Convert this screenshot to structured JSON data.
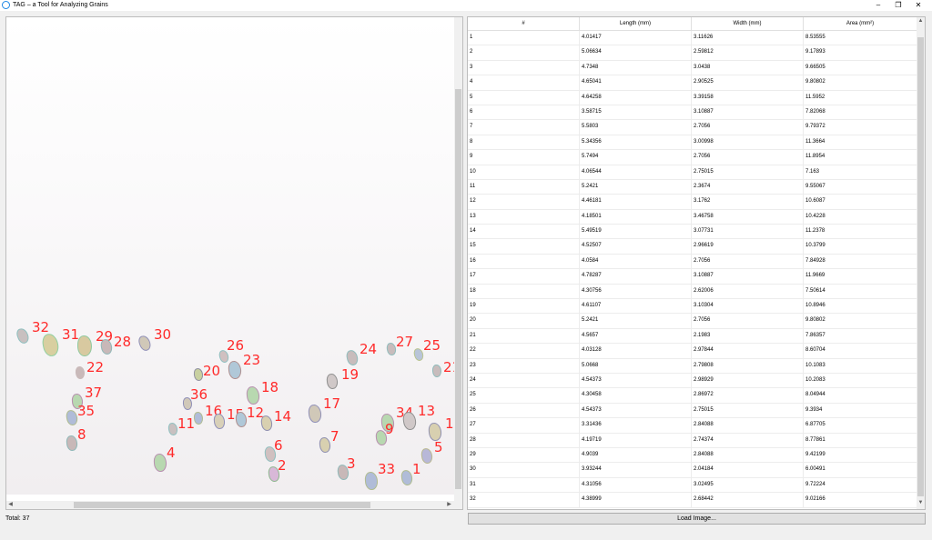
{
  "window": {
    "title": "TAG – a Tool for Analyzing Grains",
    "minimize_icon": "–",
    "maximize_icon": "❐",
    "close_icon": "✕"
  },
  "image_view": {
    "labels": [
      "32",
      "31",
      "29",
      "28",
      "30",
      "26",
      "22",
      "20",
      "23",
      "18",
      "24",
      "27",
      "25",
      "21",
      "19",
      "37",
      "36",
      "35",
      "16",
      "15",
      "12",
      "14",
      "11",
      "17",
      "34",
      "13",
      "10",
      "9",
      "8",
      "6",
      "7",
      "5",
      "4",
      "2",
      "3",
      "33",
      "1"
    ]
  },
  "table": {
    "columns": [
      "#",
      "Length (mm)",
      "Width (mm)",
      "Area (mm²)"
    ],
    "rows": [
      [
        "1",
        "4.01417",
        "3.11626",
        "8.53555"
      ],
      [
        "2",
        "5.06634",
        "2.59812",
        "9.17893"
      ],
      [
        "3",
        "4.7348",
        "3.0438",
        "9.66505"
      ],
      [
        "4",
        "4.65041",
        "2.90525",
        "9.80802"
      ],
      [
        "5",
        "4.64258",
        "3.39158",
        "11.5952"
      ],
      [
        "6",
        "3.58715",
        "3.10887",
        "7.82068"
      ],
      [
        "7",
        "5.5803",
        "2.7056",
        "9.79372"
      ],
      [
        "8",
        "5.34356",
        "3.00998",
        "11.3664"
      ],
      [
        "9",
        "5.7494",
        "2.7056",
        "11.8954"
      ],
      [
        "10",
        "4.06544",
        "2.75015",
        "7.163"
      ],
      [
        "11",
        "5.2421",
        "2.3674",
        "9.55067"
      ],
      [
        "12",
        "4.46181",
        "3.1762",
        "10.6087"
      ],
      [
        "13",
        "4.18501",
        "3.46758",
        "10.4228"
      ],
      [
        "14",
        "5.49519",
        "3.07731",
        "11.2378"
      ],
      [
        "15",
        "4.52507",
        "2.96619",
        "10.3799"
      ],
      [
        "16",
        "4.0584",
        "2.7056",
        "7.84928"
      ],
      [
        "17",
        "4.78287",
        "3.10887",
        "11.9669"
      ],
      [
        "18",
        "4.30756",
        "2.62006",
        "7.50614"
      ],
      [
        "19",
        "4.61107",
        "3.10304",
        "10.8946"
      ],
      [
        "20",
        "5.2421",
        "2.7056",
        "9.80802"
      ],
      [
        "21",
        "4.5657",
        "2.1983",
        "7.86357"
      ],
      [
        "22",
        "4.03128",
        "2.97844",
        "8.60704"
      ],
      [
        "23",
        "5.0668",
        "2.79808",
        "10.1083"
      ],
      [
        "24",
        "4.54373",
        "2.98929",
        "10.2083"
      ],
      [
        "25",
        "4.30458",
        "2.86972",
        "8.04944"
      ],
      [
        "26",
        "4.54373",
        "2.75015",
        "9.3934"
      ],
      [
        "27",
        "3.31436",
        "2.84088",
        "6.87705"
      ],
      [
        "28",
        "4.19719",
        "2.74374",
        "8.77861"
      ],
      [
        "29",
        "4.9039",
        "2.84088",
        "9.42199"
      ],
      [
        "30",
        "3.93244",
        "2.04184",
        "6.00491"
      ],
      [
        "31",
        "4.31056",
        "3.02495",
        "9.72224"
      ],
      [
        "32",
        "4.38999",
        "2.68442",
        "9.02166"
      ]
    ]
  },
  "status": {
    "total": "Total: 37"
  },
  "buttons": {
    "load_image": "Load Image..."
  }
}
